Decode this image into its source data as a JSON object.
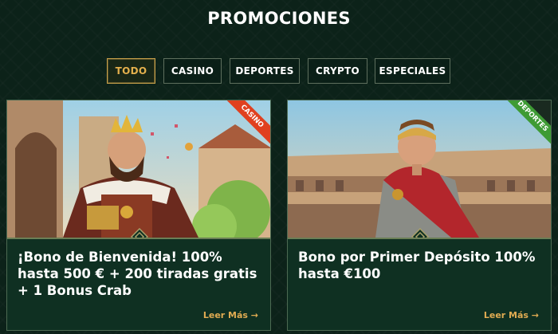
{
  "page": {
    "title": "PROMOCIONES"
  },
  "tabs": [
    {
      "label": "TODO",
      "active": true
    },
    {
      "label": "CASINO",
      "active": false
    },
    {
      "label": "DEPORTES",
      "active": false
    },
    {
      "label": "CRYPTO",
      "active": false
    },
    {
      "label": "ESPECIALES",
      "active": false
    }
  ],
  "promos": [
    {
      "badge": "CASINO",
      "badge_color": "#e0401f",
      "title": "¡Bono de Bienvenida! 100% hasta 500 € + 200 tiradas gratis + 1 Bonus Crab",
      "read_more": "Leer Más →",
      "image_icon": "king-illustration"
    },
    {
      "badge": "DEPORTES",
      "badge_color": "#3e9b34",
      "title": "Bono por Primer Depósito 100% hasta €100",
      "read_more": "Leer Más →",
      "image_icon": "gladiator-illustration"
    }
  ],
  "colors": {
    "accent": "#e4b04d",
    "background": "#0c2219",
    "card": "#0f3022"
  }
}
